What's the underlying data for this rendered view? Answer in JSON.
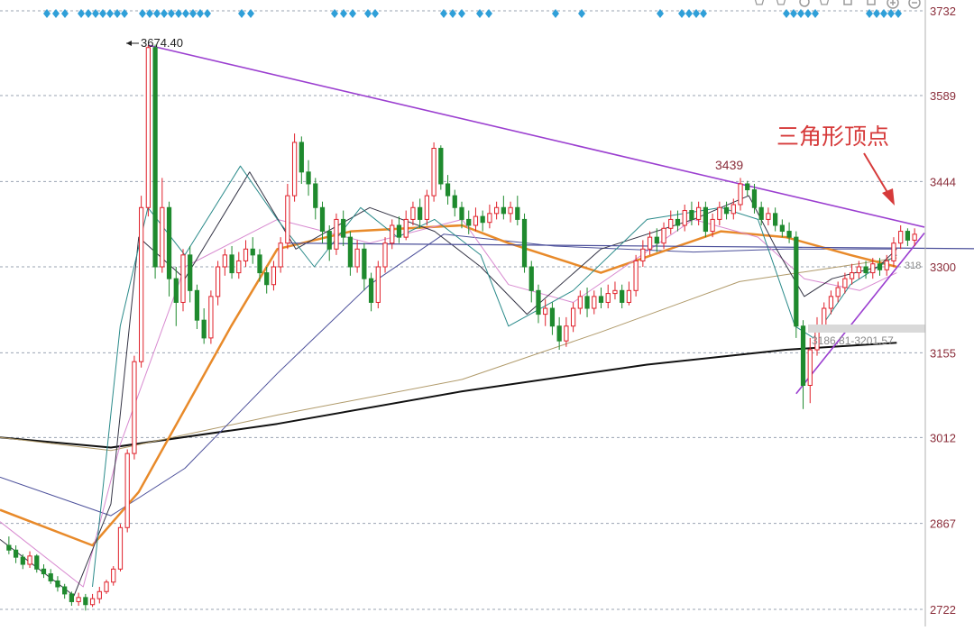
{
  "colors": {
    "up": "#e0202a",
    "down": "#1f8a2e",
    "grid": "#9aa3b2",
    "axis_text": "#8a2d3a",
    "trendline": "#9b3fd0",
    "ma_orange": "#e88a2a",
    "ma_black": "#111111",
    "ma_navy": "#4b4f9a",
    "ma_tan": "#b09a6a",
    "ma_pink": "#d88ad0",
    "ma_dark": "#333344",
    "ma_teal": "#2a8a8a",
    "marker_blue": "#2f9fd8",
    "annotation_red": "#d63a3a",
    "toolbar": "#9a9a9a"
  },
  "toolbar": {
    "icons": [
      "settings-icon",
      "line-tool-icon",
      "ring-icon",
      "hand-icon",
      "copy-icon",
      "gear-icon",
      "zoom-in-icon",
      "zoom-out-icon"
    ]
  },
  "chart_data": {
    "type": "candlestick",
    "ylim": [
      2700,
      3732
    ],
    "y_ticks": [
      3732,
      3589,
      3444,
      3300,
      3155,
      3012,
      2867,
      2722
    ],
    "grid": true,
    "price_labels": {
      "high_label": "3674.40",
      "peak_label": "3439",
      "range_label": "3186.81-3201.57",
      "right_edge_label": "318"
    },
    "annotation": {
      "text": "三角形顶点"
    },
    "candles": [
      [
        2830,
        2822,
        2845,
        2815
      ],
      [
        2822,
        2810,
        2830,
        2800
      ],
      [
        2810,
        2798,
        2815,
        2790
      ],
      [
        2798,
        2812,
        2820,
        2792
      ],
      [
        2812,
        2790,
        2815,
        2784
      ],
      [
        2790,
        2782,
        2798,
        2775
      ],
      [
        2782,
        2770,
        2790,
        2765
      ],
      [
        2770,
        2760,
        2778,
        2752
      ],
      [
        2760,
        2748,
        2765,
        2740
      ],
      [
        2748,
        2735,
        2752,
        2728
      ],
      [
        2735,
        2742,
        2750,
        2728
      ],
      [
        2742,
        2730,
        2748,
        2720
      ],
      [
        2730,
        2740,
        2748,
        2726
      ],
      [
        2740,
        2752,
        2760,
        2732
      ],
      [
        2752,
        2768,
        2772,
        2748
      ],
      [
        2768,
        2790,
        2795,
        2762
      ],
      [
        2790,
        2860,
        2866,
        2786
      ],
      [
        2860,
        2985,
        2992,
        2852
      ],
      [
        2985,
        3140,
        3150,
        2975
      ],
      [
        3140,
        3400,
        3420,
        3130
      ],
      [
        3400,
        3670,
        3674,
        3385
      ],
      [
        3670,
        3300,
        3675,
        3280
      ],
      [
        3300,
        3400,
        3450,
        3290
      ],
      [
        3400,
        3280,
        3410,
        3250
      ],
      [
        3280,
        3240,
        3300,
        3200
      ],
      [
        3240,
        3320,
        3330,
        3225
      ],
      [
        3320,
        3260,
        3335,
        3240
      ],
      [
        3260,
        3210,
        3270,
        3195
      ],
      [
        3210,
        3180,
        3230,
        3170
      ],
      [
        3180,
        3250,
        3260,
        3170
      ],
      [
        3250,
        3300,
        3310,
        3235
      ],
      [
        3300,
        3320,
        3330,
        3285
      ],
      [
        3320,
        3290,
        3335,
        3280
      ],
      [
        3290,
        3310,
        3325,
        3280
      ],
      [
        3310,
        3330,
        3345,
        3300
      ],
      [
        3330,
        3320,
        3350,
        3305
      ],
      [
        3320,
        3290,
        3330,
        3275
      ],
      [
        3290,
        3270,
        3300,
        3255
      ],
      [
        3270,
        3300,
        3310,
        3260
      ],
      [
        3300,
        3340,
        3350,
        3290
      ],
      [
        3340,
        3420,
        3440,
        3330
      ],
      [
        3420,
        3510,
        3525,
        3410
      ],
      [
        3510,
        3460,
        3520,
        3440
      ],
      [
        3460,
        3440,
        3480,
        3420
      ],
      [
        3440,
        3400,
        3450,
        3380
      ],
      [
        3400,
        3360,
        3410,
        3340
      ],
      [
        3360,
        3330,
        3370,
        3310
      ],
      [
        3330,
        3380,
        3390,
        3320
      ],
      [
        3380,
        3350,
        3395,
        3335
      ],
      [
        3350,
        3300,
        3360,
        3285
      ],
      [
        3300,
        3330,
        3345,
        3290
      ],
      [
        3330,
        3280,
        3340,
        3260
      ],
      [
        3280,
        3240,
        3290,
        3225
      ],
      [
        3240,
        3300,
        3310,
        3230
      ],
      [
        3300,
        3340,
        3350,
        3290
      ],
      [
        3340,
        3370,
        3380,
        3330
      ],
      [
        3370,
        3350,
        3385,
        3340
      ],
      [
        3350,
        3380,
        3395,
        3345
      ],
      [
        3380,
        3400,
        3410,
        3370
      ],
      [
        3400,
        3380,
        3415,
        3365
      ],
      [
        3380,
        3420,
        3430,
        3370
      ],
      [
        3420,
        3500,
        3510,
        3410
      ],
      [
        3500,
        3440,
        3505,
        3430
      ],
      [
        3440,
        3420,
        3455,
        3405
      ],
      [
        3420,
        3400,
        3430,
        3385
      ],
      [
        3400,
        3380,
        3410,
        3365
      ],
      [
        3380,
        3370,
        3395,
        3355
      ],
      [
        3370,
        3385,
        3400,
        3360
      ],
      [
        3385,
        3375,
        3395,
        3360
      ],
      [
        3375,
        3390,
        3405,
        3365
      ],
      [
        3390,
        3400,
        3410,
        3380
      ],
      [
        3400,
        3390,
        3420,
        3380
      ],
      [
        3390,
        3400,
        3410,
        3375
      ],
      [
        3400,
        3380,
        3420,
        3370
      ],
      [
        3380,
        3300,
        3390,
        3290
      ],
      [
        3300,
        3260,
        3310,
        3240
      ],
      [
        3260,
        3220,
        3270,
        3205
      ],
      [
        3220,
        3230,
        3245,
        3200
      ],
      [
        3230,
        3200,
        3240,
        3185
      ],
      [
        3200,
        3175,
        3215,
        3160
      ],
      [
        3175,
        3200,
        3215,
        3165
      ],
      [
        3200,
        3230,
        3240,
        3190
      ],
      [
        3230,
        3250,
        3260,
        3220
      ],
      [
        3250,
        3230,
        3265,
        3215
      ],
      [
        3230,
        3250,
        3260,
        3220
      ],
      [
        3250,
        3240,
        3265,
        3230
      ],
      [
        3240,
        3255,
        3270,
        3230
      ],
      [
        3255,
        3260,
        3275,
        3245
      ],
      [
        3260,
        3240,
        3270,
        3230
      ],
      [
        3240,
        3260,
        3275,
        3235
      ],
      [
        3260,
        3310,
        3320,
        3250
      ],
      [
        3310,
        3330,
        3345,
        3300
      ],
      [
        3330,
        3350,
        3360,
        3320
      ],
      [
        3350,
        3340,
        3365,
        3325
      ],
      [
        3340,
        3365,
        3375,
        3330
      ],
      [
        3365,
        3380,
        3395,
        3355
      ],
      [
        3380,
        3370,
        3395,
        3360
      ],
      [
        3370,
        3395,
        3405,
        3360
      ],
      [
        3395,
        3380,
        3410,
        3370
      ],
      [
        3380,
        3400,
        3410,
        3370
      ],
      [
        3400,
        3360,
        3410,
        3350
      ],
      [
        3360,
        3380,
        3390,
        3350
      ],
      [
        3380,
        3400,
        3410,
        3370
      ],
      [
        3400,
        3390,
        3410,
        3380
      ],
      [
        3390,
        3405,
        3415,
        3380
      ],
      [
        3405,
        3440,
        3450,
        3395
      ],
      [
        3440,
        3430,
        3445,
        3420
      ],
      [
        3430,
        3400,
        3440,
        3390
      ],
      [
        3400,
        3380,
        3410,
        3370
      ],
      [
        3380,
        3390,
        3400,
        3370
      ],
      [
        3390,
        3370,
        3400,
        3360
      ],
      [
        3370,
        3360,
        3380,
        3350
      ],
      [
        3360,
        3350,
        3375,
        3340
      ],
      [
        3350,
        3200,
        3360,
        3180
      ],
      [
        3200,
        3100,
        3210,
        3060
      ],
      [
        3100,
        3160,
        3180,
        3070
      ],
      [
        3160,
        3200,
        3215,
        3150
      ],
      [
        3200,
        3230,
        3240,
        3190
      ],
      [
        3230,
        3250,
        3260,
        3220
      ],
      [
        3250,
        3265,
        3275,
        3240
      ],
      [
        3265,
        3280,
        3290,
        3255
      ],
      [
        3280,
        3290,
        3305,
        3270
      ],
      [
        3290,
        3300,
        3310,
        3280
      ],
      [
        3300,
        3290,
        3310,
        3280
      ],
      [
        3290,
        3305,
        3315,
        3280
      ],
      [
        3305,
        3295,
        3315,
        3285
      ],
      [
        3295,
        3310,
        3320,
        3285
      ],
      [
        3310,
        3340,
        3350,
        3300
      ],
      [
        3340,
        3360,
        3370,
        3330
      ],
      [
        3360,
        3345,
        3365,
        3335
      ],
      [
        3345,
        3355,
        3365,
        3335
      ]
    ],
    "moving_averages": [
      {
        "color_key": "ma_black",
        "width": 2,
        "values": [
          [
            0,
            3012
          ],
          [
            0.12,
            2995
          ],
          [
            0.3,
            3035
          ],
          [
            0.5,
            3090
          ],
          [
            0.7,
            3135
          ],
          [
            0.85,
            3160
          ],
          [
            0.97,
            3172
          ]
        ]
      },
      {
        "color_key": "ma_tan",
        "width": 1,
        "values": [
          [
            0,
            3012
          ],
          [
            0.12,
            2990
          ],
          [
            0.3,
            3050
          ],
          [
            0.5,
            3110
          ],
          [
            0.65,
            3190
          ],
          [
            0.8,
            3275
          ],
          [
            0.95,
            3310
          ],
          [
            0.97,
            3315
          ]
        ]
      },
      {
        "color_key": "ma_navy",
        "width": 1,
        "values": [
          [
            0,
            2945
          ],
          [
            0.12,
            2880
          ],
          [
            0.2,
            2960
          ],
          [
            0.3,
            3120
          ],
          [
            0.4,
            3270
          ],
          [
            0.48,
            3355
          ],
          [
            0.6,
            3335
          ],
          [
            0.75,
            3325
          ],
          [
            0.85,
            3330
          ],
          [
            0.97,
            3330
          ]
        ]
      },
      {
        "color_key": "ma_orange",
        "width": 2.5,
        "values": [
          [
            0,
            2890
          ],
          [
            0.1,
            2830
          ],
          [
            0.15,
            2920
          ],
          [
            0.25,
            3200
          ],
          [
            0.3,
            3330
          ],
          [
            0.38,
            3360
          ],
          [
            0.5,
            3370
          ],
          [
            0.55,
            3340
          ],
          [
            0.65,
            3290
          ],
          [
            0.78,
            3360
          ],
          [
            0.85,
            3350
          ],
          [
            0.92,
            3320
          ],
          [
            0.97,
            3300
          ]
        ]
      },
      {
        "color_key": "ma_pink",
        "width": 1,
        "values": [
          [
            0,
            2870
          ],
          [
            0.09,
            2760
          ],
          [
            0.13,
            3000
          ],
          [
            0.2,
            3300
          ],
          [
            0.3,
            3380
          ],
          [
            0.4,
            3340
          ],
          [
            0.5,
            3380
          ],
          [
            0.55,
            3270
          ],
          [
            0.62,
            3240
          ],
          [
            0.75,
            3380
          ],
          [
            0.82,
            3350
          ],
          [
            0.87,
            3280
          ],
          [
            0.93,
            3260
          ],
          [
            0.97,
            3290
          ]
        ]
      },
      {
        "color_key": "ma_dark",
        "width": 1,
        "values": [
          [
            0,
            2840
          ],
          [
            0.08,
            2745
          ],
          [
            0.12,
            2900
          ],
          [
            0.15,
            3350
          ],
          [
            0.2,
            3280
          ],
          [
            0.27,
            3460
          ],
          [
            0.32,
            3330
          ],
          [
            0.4,
            3400
          ],
          [
            0.47,
            3360
          ],
          [
            0.52,
            3300
          ],
          [
            0.57,
            3220
          ],
          [
            0.65,
            3330
          ],
          [
            0.75,
            3380
          ],
          [
            0.81,
            3420
          ],
          [
            0.84,
            3330
          ],
          [
            0.87,
            3250
          ],
          [
            0.9,
            3280
          ],
          [
            0.95,
            3300
          ],
          [
            0.97,
            3330
          ]
        ]
      },
      {
        "color_key": "ma_teal",
        "width": 1,
        "values": [
          [
            0.1,
            2760
          ],
          [
            0.13,
            3200
          ],
          [
            0.16,
            3400
          ],
          [
            0.2,
            3320
          ],
          [
            0.26,
            3470
          ],
          [
            0.3,
            3380
          ],
          [
            0.34,
            3300
          ],
          [
            0.39,
            3400
          ],
          [
            0.43,
            3350
          ],
          [
            0.47,
            3380
          ],
          [
            0.52,
            3320
          ],
          [
            0.55,
            3200
          ],
          [
            0.62,
            3260
          ],
          [
            0.7,
            3380
          ],
          [
            0.78,
            3400
          ],
          [
            0.82,
            3380
          ],
          [
            0.86,
            3200
          ],
          [
            0.88,
            3180
          ],
          [
            0.92,
            3270
          ],
          [
            0.97,
            3320
          ]
        ]
      }
    ],
    "trendlines": [
      {
        "from": [
          20,
          3674
        ],
        "to": [
          145,
          3367
        ]
      },
      {
        "from": [
          113,
          3086
        ],
        "to": [
          145,
          3357
        ]
      }
    ],
    "level_lines": [
      {
        "color_key": "ma_navy",
        "from": [
          40,
          3340
        ],
        "to": [
          145,
          3330
        ]
      }
    ]
  }
}
